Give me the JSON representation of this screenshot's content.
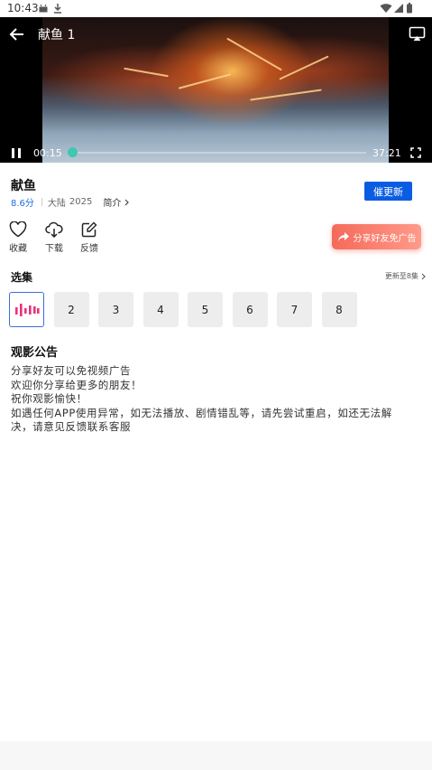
{
  "status_bar": {
    "time": "10:43"
  },
  "player": {
    "title": "献鱼 1",
    "current_time": "00:15",
    "total_time": "37:21",
    "progress": 0.007
  },
  "show": {
    "title": "献鱼",
    "score": "8.6分",
    "region": "大陆",
    "year": "2025",
    "intro_label": "简介",
    "urge_label": "催更新"
  },
  "actions": [
    {
      "label": "收藏",
      "icon": "heart-icon"
    },
    {
      "label": "下载",
      "icon": "download-icon"
    },
    {
      "label": "反馈",
      "icon": "feedback-icon"
    }
  ],
  "share": {
    "label": "分享好友免广告"
  },
  "episodes": {
    "title": "选集",
    "update_info": "更新至8集",
    "items": [
      "2",
      "3",
      "4",
      "5",
      "6",
      "7",
      "8"
    ],
    "playing_icon": "playing-bars-icon"
  },
  "notice": {
    "title": "观影公告",
    "lines": [
      "分享好友可以免视频广告",
      "欢迎你分享给更多的朋友！",
      "祝你观影愉快！",
      "如遇任何APP使用异常，如无法播放、剧情错乱等，请先尝试重启，如还无法解",
      "决，请意见反馈联系客服"
    ]
  },
  "colors": {
    "accent_blue": "#0a5de3",
    "progress_teal": "#3fc7b4",
    "share_gradient_start": "#f56a5a",
    "playing_pink": "#e9327a"
  }
}
